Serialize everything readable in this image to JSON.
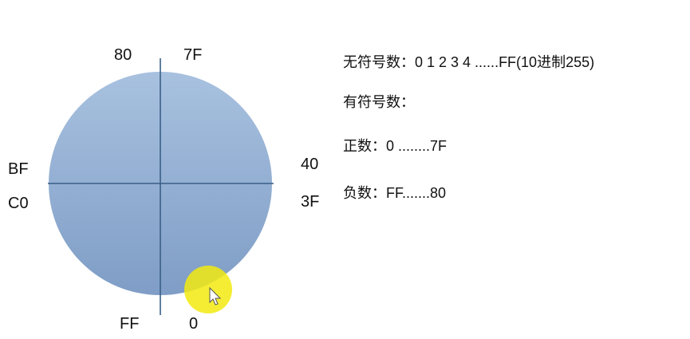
{
  "diagram": {
    "labels": {
      "top_left": "80",
      "top_right": "7F",
      "left_top": "BF",
      "left_bottom": "C0",
      "right_top": "40",
      "right_bottom": "3F",
      "bottom_left": "FF",
      "bottom_right": "0"
    },
    "colors": {
      "circle_top": "#a8c1df",
      "circle_bottom": "#7f9dc6",
      "axis": "#3a5f87",
      "cursor_highlight": "#f2ea10"
    }
  },
  "notes": {
    "unsigned": "无符号数：0 1 2 3 4 ......FF(10进制255)",
    "signed": "有符号数：",
    "positive": "正数：0 ........7F",
    "negative": "负数：FF.......80"
  }
}
